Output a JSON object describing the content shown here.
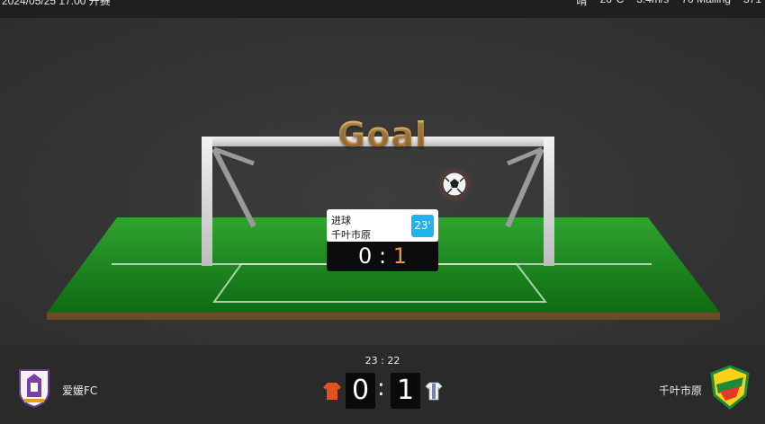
{
  "status_bar": {
    "left_text": "2024/05/25 17:00 开赛",
    "right_items": [
      "晴",
      "26°C",
      "3.4m/s",
      "70 Malling",
      "371"
    ]
  },
  "event": {
    "title": "Goal",
    "type_label": "进球",
    "team_label": "千叶市原",
    "minute": "23'",
    "home_score": "0",
    "separator": ":",
    "away_score": "1"
  },
  "scoreboard": {
    "match_clock": "23 : 22",
    "home_team": "爱媛FC",
    "away_team": "千叶市原",
    "home_score": "0",
    "away_score": "1",
    "separator": ":"
  },
  "colors": {
    "title_gold": "#e3a553",
    "minute_badge": "#1fb4f0",
    "away_highlight": "#e99a3a",
    "pitch_green": "#1f8a1f",
    "home_kit": "#e0531e",
    "away_kit": "#f2f2f2"
  }
}
